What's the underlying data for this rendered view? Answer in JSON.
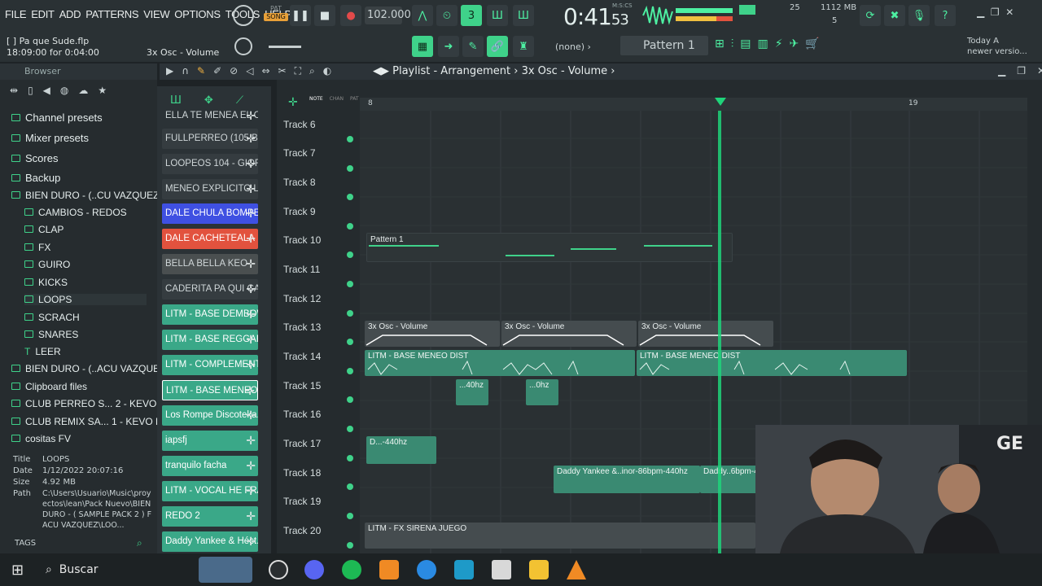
{
  "colors": {
    "accent": "#3fd28a",
    "bg": "#1e2326",
    "playhead": "#1fd47a",
    "channel_red": "#e2523e",
    "channel_blue": "#3f50e2"
  },
  "menu": [
    "FILE",
    "EDIT",
    "ADD",
    "PATTERNS",
    "VIEW",
    "OPTIONS",
    "TOOLS",
    "HELP"
  ],
  "transport": {
    "pat": "PAT",
    "song": "SONG",
    "tempo": "102.000",
    "time_main": "0:41",
    "time_sub": "53",
    "time_label": "M:S:CS"
  },
  "project": {
    "file": "Pa que Sude.flp",
    "time_info": "18:09:00 for 0:04:00",
    "hint": "3x Osc - Volume"
  },
  "system": {
    "cpu": "25",
    "memory": "1112 MB",
    "voices": "5"
  },
  "toolbar": {
    "snap": "(none)",
    "pattern": "Pattern 1",
    "news_title": "Today",
    "news_flag": "A",
    "news_text": "newer versio..."
  },
  "browser": {
    "title": "Browser",
    "items": [
      "Channel presets",
      "Mixer presets",
      "Scores",
      "Backup",
      "BIEN DURO - (..CU VAZQUEZ",
      "CAMBIOS - REDOS",
      "CLAP",
      "FX",
      "GUIRO",
      "KICKS",
      "LOOPS",
      "SCRACH",
      "SNARES",
      "LEER",
      "BIEN DURO - (..ACU VAZQUEZ",
      "Clipboard files",
      "CLUB PERREO S... 2 - KEVO DJ",
      "CLUB REMIX SA... 1 - KEVO DJ",
      "cositas FV"
    ],
    "info": {
      "title_label": "Title",
      "title": "LOOPS",
      "date_label": "Date",
      "date": "1/12/2022 20:07:16",
      "size_label": "Size",
      "size": "4.92 MB",
      "path_label": "Path",
      "path": "C:\\Users\\Usuario\\Music\\proyectos\\lean\\Pack Nuevo\\BIEN DURO - ( SAMPLE PACK 2 ) FACU VAZQUEZ\\LOO..."
    },
    "tags": "TAGS"
  },
  "channels": [
    "ELLA TE MENEA EL CO...",
    "FULLPERREO (105 BP...",
    "LOOPEOS 104 - GIORGI",
    "MENEO EXPLICITO LO...",
    "DALE CHULA BOMPEA",
    "DALE CACHETEALA",
    "BELLA BELLA KEO",
    "CADERITA PA QUI CAD...",
    "LITM - BASE DEMBOW...",
    "LITM - BASE REGGAET...",
    "LITM - COMPLEMENTO...",
    "LITM - BASE MENEO D...",
    "Los Rompe Discoteka...",
    "iapsfj",
    "tranquilo facha",
    "LITM - VOCAL HE FRA...",
    "REDO 2",
    "Daddy Yankee & Héct..."
  ],
  "playlist": {
    "title": "Playlist - Arrangement",
    "crumb": "3x Osc - Volume",
    "tabs": [
      "NOTE",
      "CHAN",
      "PAT"
    ],
    "ruler": [
      "8",
      "19"
    ],
    "tracks": [
      "Track 6",
      "Track 7",
      "Track 8",
      "Track 9",
      "Track 10",
      "Track 11",
      "Track 12",
      "Track 13",
      "Track 14",
      "Track 15",
      "Track 16",
      "Track 17",
      "Track 18",
      "Track 19",
      "Track 20"
    ],
    "clips": {
      "pattern": "Pattern 1",
      "auto": "3x Osc - Volume",
      "meneo": "LITM - BASE MENEO DIST",
      "hz40": "...40hz",
      "hz0": "...0hz",
      "d440": "D...-440hz",
      "daddy": "Daddy Yankee &..inor-86bpm-440hz",
      "daddy2": "Daddy..6bpm-4",
      "sirena": "LITM - FX SIRENA JUEGO"
    }
  },
  "taskbar": {
    "search": "Buscar"
  }
}
